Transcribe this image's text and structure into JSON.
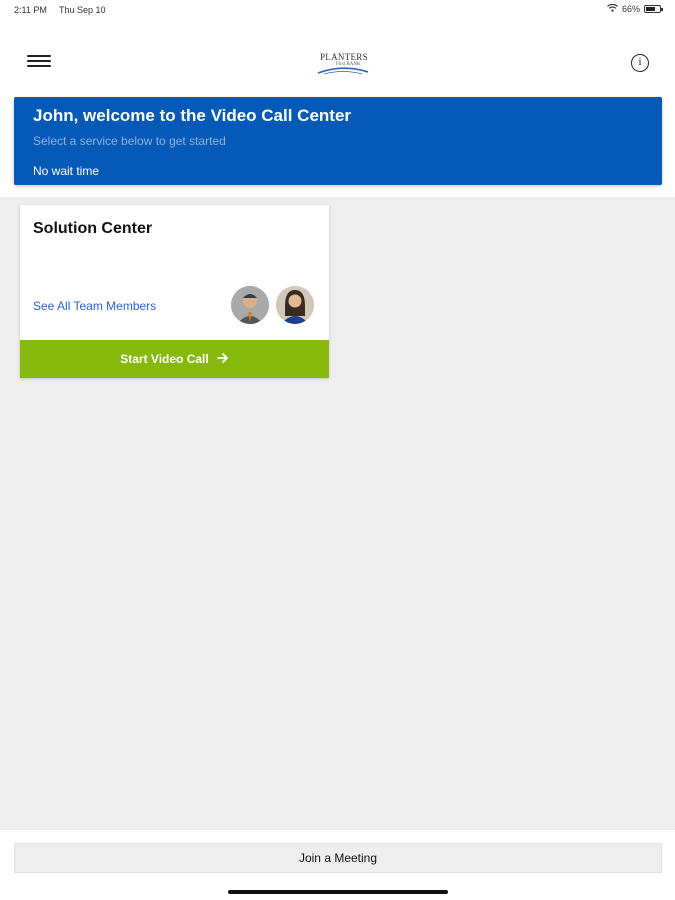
{
  "status_bar": {
    "time": "2:11 PM",
    "date": "Thu Sep 10",
    "battery": "66%",
    "battery_level": 0.66
  },
  "nav": {
    "logo_line1": "PLANTERS",
    "logo_line2": "First BANK",
    "info_glyph": "i",
    "icons": [
      "hamburger-menu-icon",
      "info-icon"
    ]
  },
  "banner": {
    "title": "John, welcome to the Video Call Center",
    "subtitle": "Select a service below to get started",
    "wait_text": "No wait time",
    "background_color": "#0559b7"
  },
  "service_card": {
    "name": "Solution Center",
    "team_link": "See All Team Members",
    "button_label": "Start Video Call",
    "button_icon": "arrow-right-icon",
    "button_color": "#86b80d"
  },
  "footer": {
    "join_label": "Join a Meeting"
  }
}
